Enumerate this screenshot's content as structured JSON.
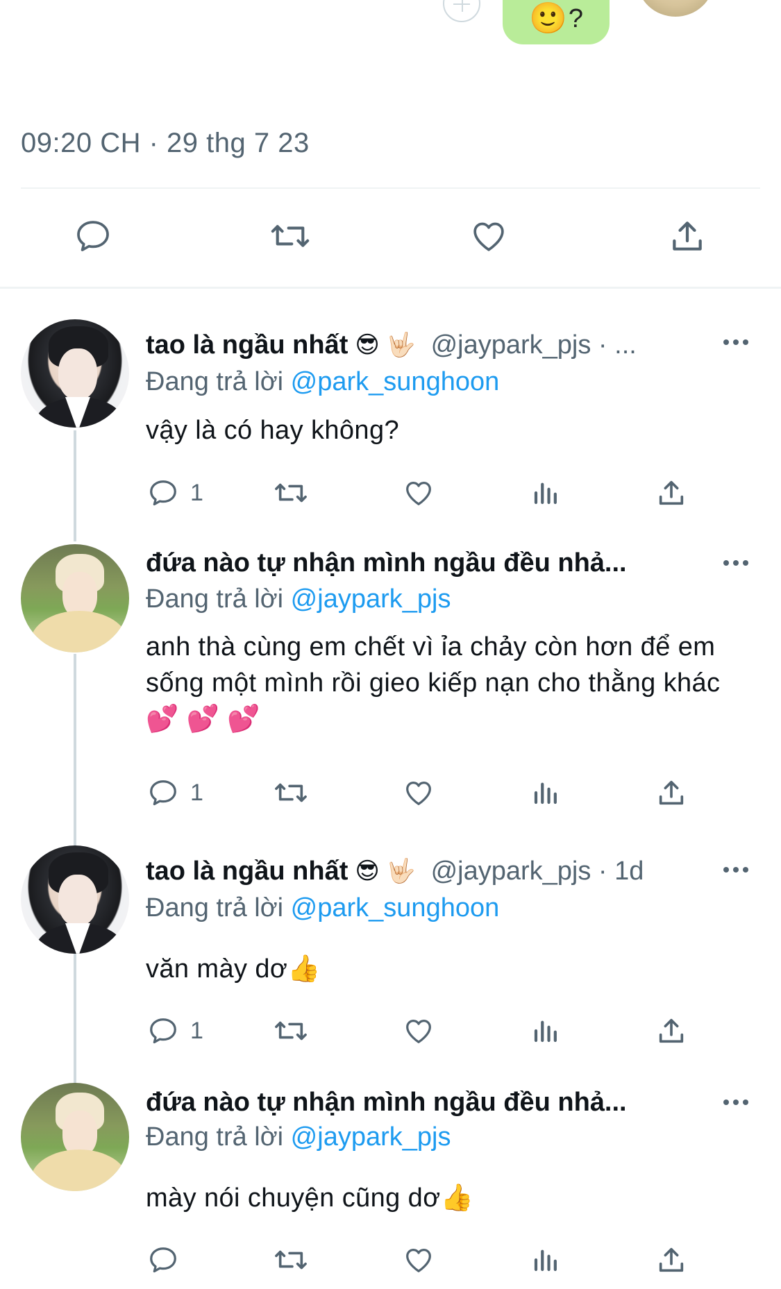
{
  "top": {
    "reaction_emoji": "🙂",
    "reaction_suffix": "?",
    "timestamp": "09:20 CH · 29 thg 7 23"
  },
  "main_actions": [
    "reply-icon",
    "retweet-icon",
    "like-icon",
    "share-icon"
  ],
  "colors": {
    "text": "#0f1419",
    "secondary": "#536471",
    "link": "#1d9bf0",
    "divider": "#eff3f4",
    "bubble": "#b9ec99"
  },
  "replies": [
    {
      "name": "tao là ngầu nhất",
      "name_emoji": "😎 🤟🏻",
      "handle": "@jaypark_pjs · ...",
      "replying_prefix": "Đang trả lời",
      "replying_to": "@park_sunghoon",
      "text": "vậy là có hay không?",
      "reply_count": "1"
    },
    {
      "name": "đứa nào tự nhận mình ngầu đều nhả...",
      "name_emoji": "",
      "handle": "",
      "replying_prefix": "Đang trả lời",
      "replying_to": "@jaypark_pjs",
      "text": "anh thà cùng em chết vì ỉa chảy còn hơn để em sống một mình rồi gieo kiếp nạn cho thằng khác 💕 💕 💕",
      "reply_count": "1"
    },
    {
      "name": "tao là ngầu nhất",
      "name_emoji": "😎 🤟🏻",
      "handle": "@jaypark_pjs · 1d",
      "replying_prefix": "Đang trả lời",
      "replying_to": "@park_sunghoon",
      "text": "văn mày dơ👍",
      "reply_count": "1"
    },
    {
      "name": "đứa nào tự nhận mình ngầu đều nhả...",
      "name_emoji": "",
      "handle": "",
      "replying_prefix": "Đang trả lời",
      "replying_to": "@jaypark_pjs",
      "text": "mày nói chuyện cũng dơ👍",
      "reply_count": ""
    }
  ]
}
